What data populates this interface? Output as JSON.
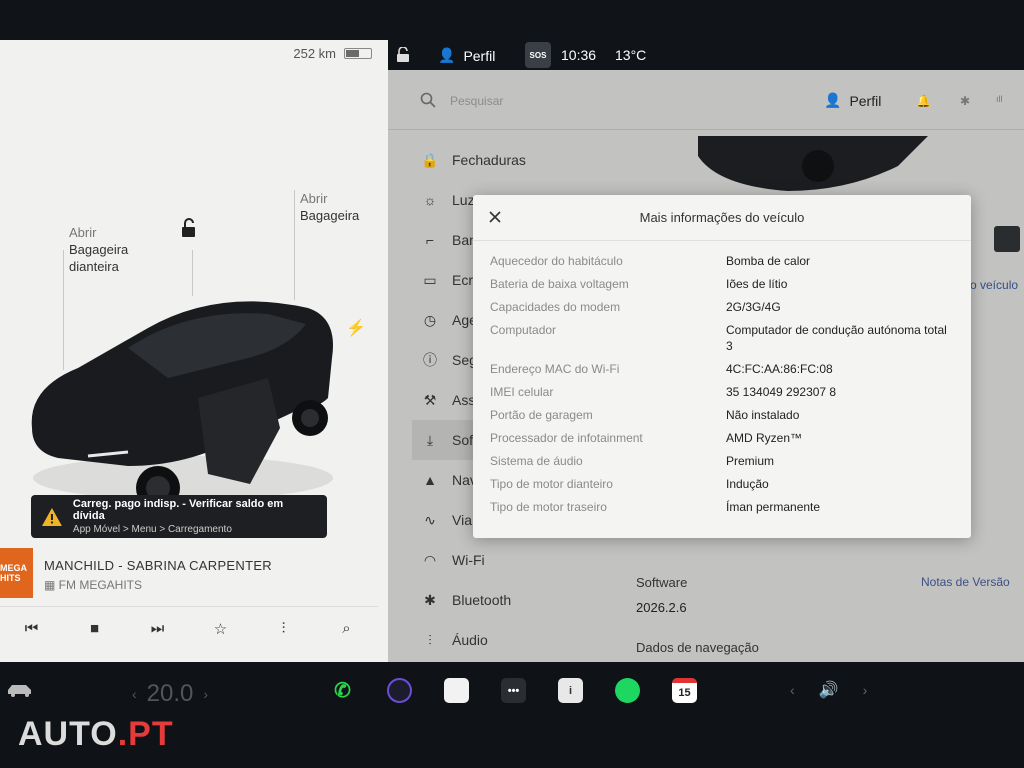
{
  "left_panel": {
    "range": "252 km",
    "battery_level": 0.55,
    "front_trunk": {
      "action": "Abrir",
      "label": "Bagageira dianteira"
    },
    "rear_trunk": {
      "action": "Abrir",
      "label": "Bagageira"
    },
    "alert": {
      "title": "Carreg. pago indisp. - Verificar saldo em dívida",
      "path": "App Móvel > Menu > Carregamento"
    },
    "media": {
      "station_logo": "MEGA HITS",
      "song": "MANCHILD - SABRINA CARPENTER",
      "station": "FM MEGAHITS"
    }
  },
  "status_bar": {
    "profile": "Perfil",
    "sos": "SOS",
    "time": "10:36",
    "temperature": "13°C"
  },
  "settings": {
    "search_placeholder": "Pesquisar",
    "profile": "Perfil",
    "menu": [
      {
        "label": "Fechaduras",
        "icon": "lock-icon"
      },
      {
        "label": "Luz",
        "icon": "light-icon"
      },
      {
        "label": "Ban",
        "icon": "seat-icon"
      },
      {
        "label": "Ecr",
        "icon": "display-icon"
      },
      {
        "label": "Age",
        "icon": "clock-icon"
      },
      {
        "label": "Seg",
        "icon": "shield-icon"
      },
      {
        "label": "Ass",
        "icon": "wrench-icon"
      },
      {
        "label": "Sof",
        "icon": "download-icon",
        "selected": true
      },
      {
        "label": "Nav",
        "icon": "navigation-icon"
      },
      {
        "label": "Via",
        "icon": "trip-icon"
      },
      {
        "label": "Wi-Fi",
        "icon": "wifi-icon"
      },
      {
        "label": "Bluetooth",
        "icon": "bluetooth-icon"
      },
      {
        "label": "Áudio",
        "icon": "audio-icon"
      }
    ],
    "vehicle_link_hint": "o veículo",
    "software_label": "Software",
    "software_version": "2026.2.6",
    "release_notes": "Notas de Versão",
    "nav_data_label": "Dados de navegação"
  },
  "modal": {
    "title": "Mais informações do veículo",
    "rows": [
      {
        "key": "Aquecedor do habitáculo",
        "value": "Bomba de calor"
      },
      {
        "key": "Bateria de baixa voltagem",
        "value": "Iões de lítio"
      },
      {
        "key": "Capacidades do modem",
        "value": "2G/3G/4G"
      },
      {
        "key": "Computador",
        "value": "Computador de condução autónoma total 3"
      },
      {
        "key": "Endereço MAC do Wi-Fi",
        "value": "4C:FC:AA:86:FC:08"
      },
      {
        "key": "IMEI celular",
        "value": "35 134049 292307 8"
      },
      {
        "key": "Portão de garagem",
        "value": "Não instalado"
      },
      {
        "key": "Processador de infotainment",
        "value": "AMD Ryzen™"
      },
      {
        "key": "Sistema de áudio",
        "value": "Premium"
      },
      {
        "key": "Tipo de motor dianteiro",
        "value": "Indução"
      },
      {
        "key": "Tipo de motor traseiro",
        "value": "Íman permanente"
      }
    ]
  },
  "dock": {
    "cabin_temp": "20.0",
    "calendar_day": "15",
    "apps": [
      "phone-icon",
      "camera-icon",
      "notes-icon",
      "more-icon",
      "manual-icon",
      "spotify-icon",
      "calendar-icon"
    ]
  },
  "watermark": {
    "main": "AUTO",
    "suffix": ".PT"
  },
  "colors": {
    "accent_link": "#3c4f88",
    "spotify": "#1ed760",
    "phone": "#2bd34a",
    "media_art": "#e0661d"
  }
}
